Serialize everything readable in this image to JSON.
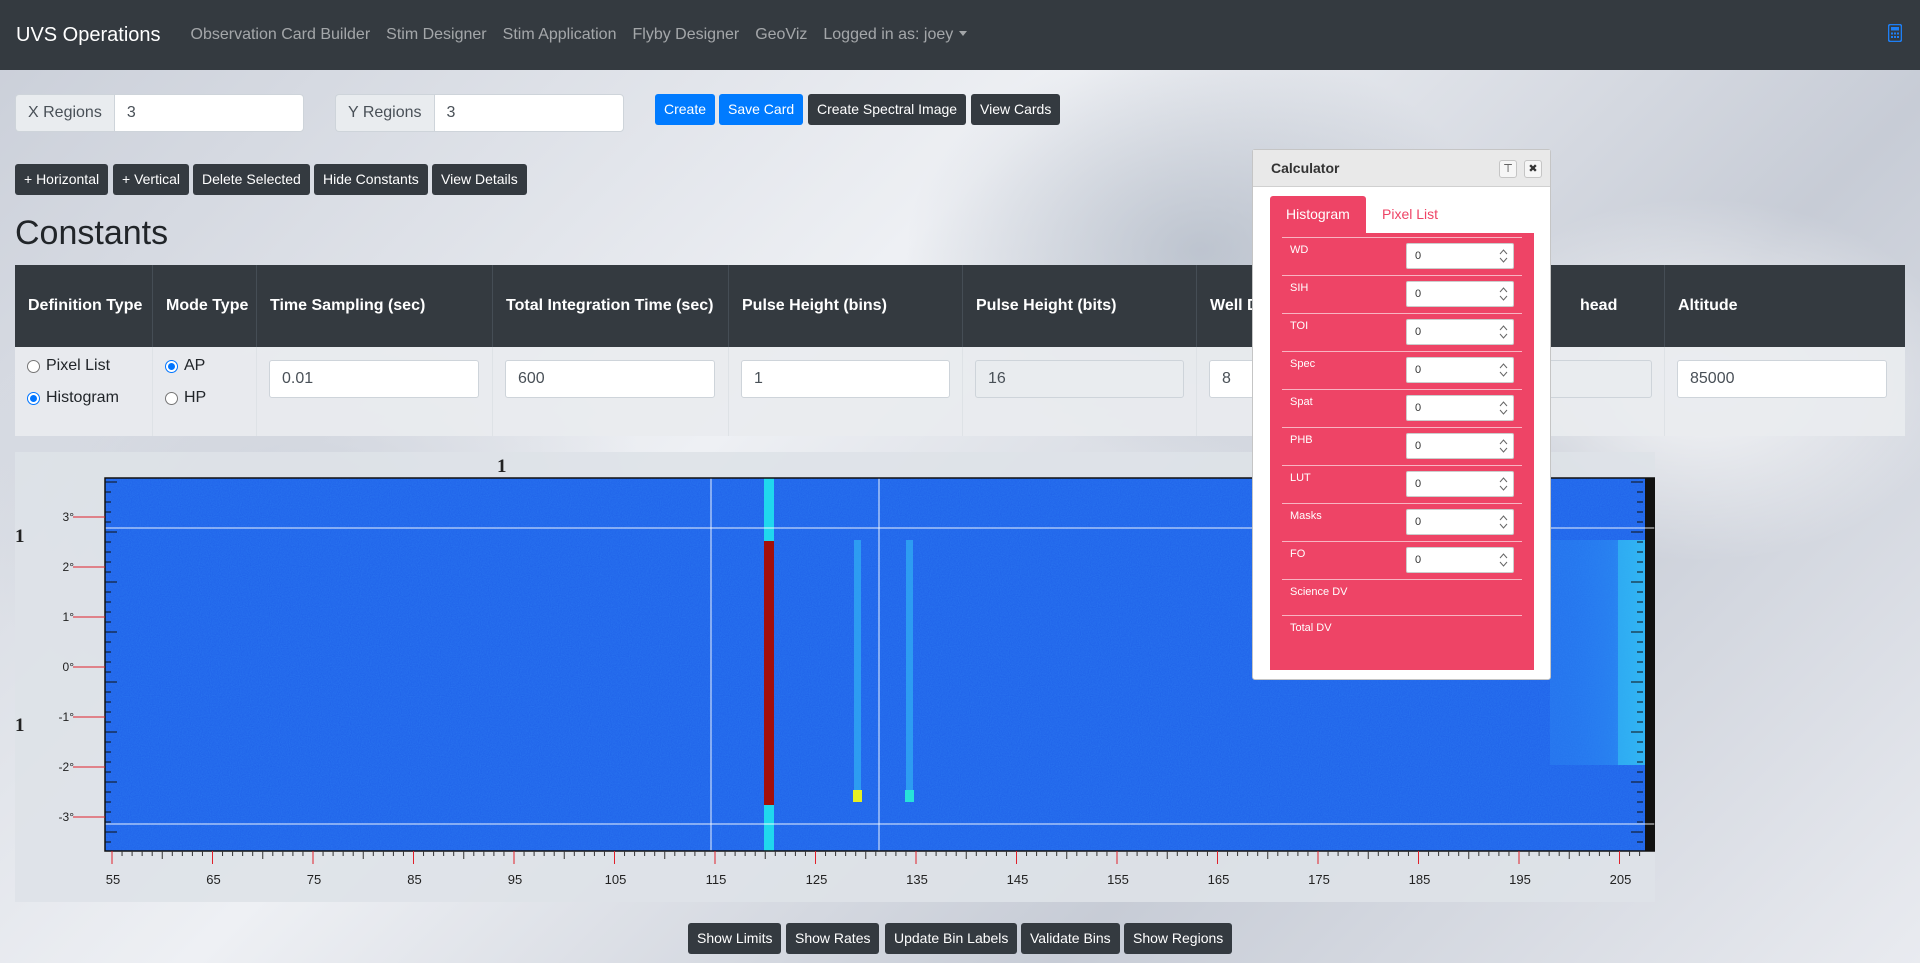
{
  "navbar": {
    "brand": "UVS Operations",
    "links": [
      "Observation Card Builder",
      "Stim Designer",
      "Stim Application",
      "Flyby Designer",
      "GeoViz"
    ],
    "user": "Logged in as: joey",
    "calculator_icon": "calculator-icon"
  },
  "regions": {
    "x_label": "X Regions",
    "x_value": "3",
    "y_label": "Y Regions",
    "y_value": "3"
  },
  "toolbar": {
    "create": "Create",
    "save_card": "Save Card",
    "create_spectral": "Create Spectral Image",
    "view_cards": "View Cards"
  },
  "edit_toolbar": {
    "horizontal": "+ Horizontal",
    "vertical": "+ Vertical",
    "delete_selected": "Delete Selected",
    "hide_constants": "Hide Constants",
    "view_details": "View Details"
  },
  "constants": {
    "heading": "Constants",
    "columns": [
      "Definition Type",
      "Mode Type",
      "Time Sampling (sec)",
      "Total Integration Time (sec)",
      "Pulse Height (bins)",
      "Pulse Height (bits)",
      "Well D",
      "head",
      "Altitude"
    ],
    "definition_options": [
      "Pixel List",
      "Histogram"
    ],
    "definition_selected": "Histogram",
    "mode_options": [
      "AP",
      "HP"
    ],
    "mode_selected": "AP",
    "values": {
      "time_sampling": "0.01",
      "total_integration": "600",
      "pulse_height_bins": "1",
      "pulse_height_bits": "16",
      "well_d": "8",
      "altitude": "85000"
    }
  },
  "plot": {
    "x_region_label": "1",
    "y_region_labels": [
      "1",
      "1"
    ],
    "x_ticks": [
      "55",
      "65",
      "75",
      "85",
      "95",
      "105",
      "115",
      "125",
      "135",
      "145",
      "155",
      "165",
      "175",
      "185",
      "195",
      "205"
    ],
    "y_ticks": [
      "3°",
      "2°",
      "1°",
      "0°",
      "-1°",
      "-2°",
      "-3°"
    ]
  },
  "bottom_toolbar": {
    "show_limits": "Show Limits",
    "show_rates": "Show Rates",
    "update_bin_labels": "Update Bin Labels",
    "validate_bins": "Validate Bins",
    "show_regions": "Show Regions"
  },
  "calculator": {
    "title": "Calculator",
    "tabs": [
      "Histogram",
      "Pixel List"
    ],
    "active_tab": "Histogram",
    "rows": [
      {
        "label": "WD",
        "value": "0"
      },
      {
        "label": "SIH",
        "value": "0"
      },
      {
        "label": "TOI",
        "value": "0"
      },
      {
        "label": "Spec",
        "value": "0"
      },
      {
        "label": "Spat",
        "value": "0"
      },
      {
        "label": "PHB",
        "value": "0"
      },
      {
        "label": "LUT",
        "value": "0"
      },
      {
        "label": "Masks",
        "value": "0"
      },
      {
        "label": "FO",
        "value": "0"
      }
    ],
    "science_dv": "Science DV",
    "total_dv": "Total DV",
    "accent_color": "#ee4466"
  }
}
